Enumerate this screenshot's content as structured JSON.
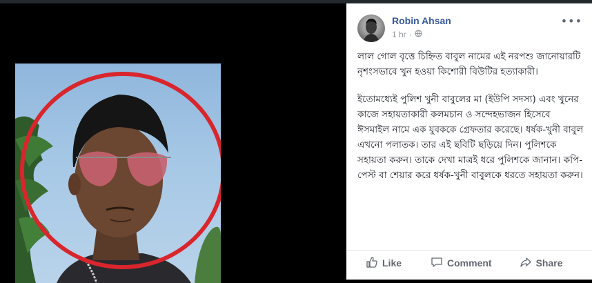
{
  "post": {
    "author": "Robin Ahsan",
    "time": "1 hr",
    "more_icon": "more-horizontal-icon",
    "paragraph1": "লাল গোল বৃত্তে চিহ্নিত বাবুল নামের এই নরপশু জানোয়ারটি নৃশংসভাবে খুন হওয়া কিশোরী বিউটির হত্যাকারী।",
    "paragraph2": "ইতোমধ্যেই পুলিশ খুনী বাবুলের মা (ইউপি সদস্য) এবং খুনের কাজে সহায়তাকারী কলমচান ও সন্দেহভাজন হিসেবে ঈসমাইল নামে এক যুবককে গ্রেফতার করেছে। ধর্ষক-খুনী বাবুল এখনো পলাতক। তার এই ছবিটি ছড়িয়ে দিন। পুলিশকে সহায়তা করুন। তাকে দেখা মাত্রই ধরে পুলিশকে জানান। কপি-পেস্ট বা শেয়ার করে ধর্ষক-খুনী বাবুলকে ধরতে সহায়তা করুন।"
  },
  "actions": {
    "like": "Like",
    "comment": "Comment",
    "share": "Share"
  },
  "colors": {
    "author": "#365899",
    "meta": "#90949c",
    "action": "#606770",
    "highlight_circle": "#d8262c"
  }
}
